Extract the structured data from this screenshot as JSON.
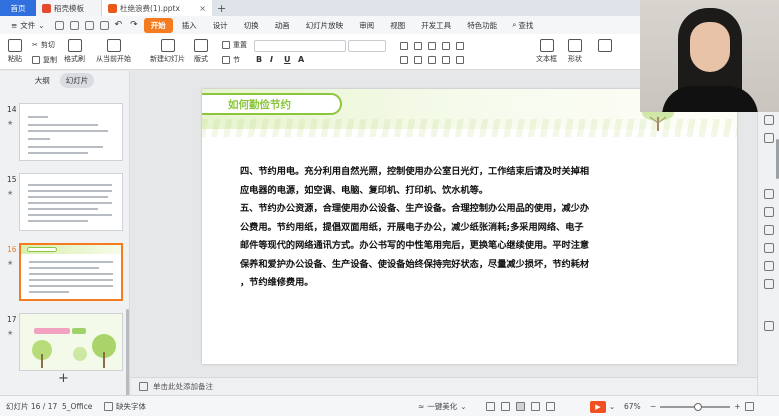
{
  "tabs": [
    {
      "label": "首页"
    },
    {
      "label": "稻壳模板"
    },
    {
      "label": "杜绝浪费(1).pptx"
    }
  ],
  "menu": {
    "file_label": "文件",
    "items": [
      "开始",
      "插入",
      "设计",
      "切换",
      "动画",
      "幻灯片放映",
      "审阅",
      "视图",
      "开发工具",
      "特色功能"
    ],
    "search_label": "查找"
  },
  "ribbon": {
    "paste": "粘贴",
    "cut": "剪切",
    "copy": "复制",
    "format_painter": "格式刷",
    "from_current": "从当前开始",
    "new_slide": "新建幻灯片",
    "layout": "版式",
    "section": "节",
    "reset": "重置",
    "textbox": "文本框",
    "shape": "形状"
  },
  "left_panel": {
    "tabs": [
      "大纲",
      "幻灯片"
    ],
    "slides": [
      {
        "number": "14"
      },
      {
        "number": "15"
      },
      {
        "number": "16"
      },
      {
        "number": "17"
      }
    ]
  },
  "slide": {
    "title": "如何勤俭节约",
    "body": [
      "四、节约用电。充分利用自然光照，控制使用办公室日光灯，工作结束后请及时关掉相",
      "应电器的电源，如空调、电脑、复印机、打印机、饮水机等。",
      "五、节约办公资源，合理使用办公设备、生产设备。合理控制办公用品的使用，减少办",
      "公费用。节约用纸，提倡双面用纸，开展电子办公，减少纸张消耗;多采用网络、电子",
      "邮件等现代的网络通讯方式。办公书写的中性笔用完后，更换笔心继续使用。平时注意",
      "保养和爱护办公设备、生产设备、使设备始终保持完好状态，尽量减少损坏，节约耗材",
      "，节约维修费用。"
    ]
  },
  "notes_placeholder": "单击此处添加备注",
  "status": {
    "slide_counter": "幻灯片 16 / 17",
    "theme": "5_Office",
    "missing_font": "缺失字体",
    "beautify": "一键美化",
    "zoom": "67%"
  },
  "colors": {
    "accent_orange": "#f47b20",
    "home_tab_blue": "#2f6fde",
    "title_green": "#8cc63f"
  }
}
